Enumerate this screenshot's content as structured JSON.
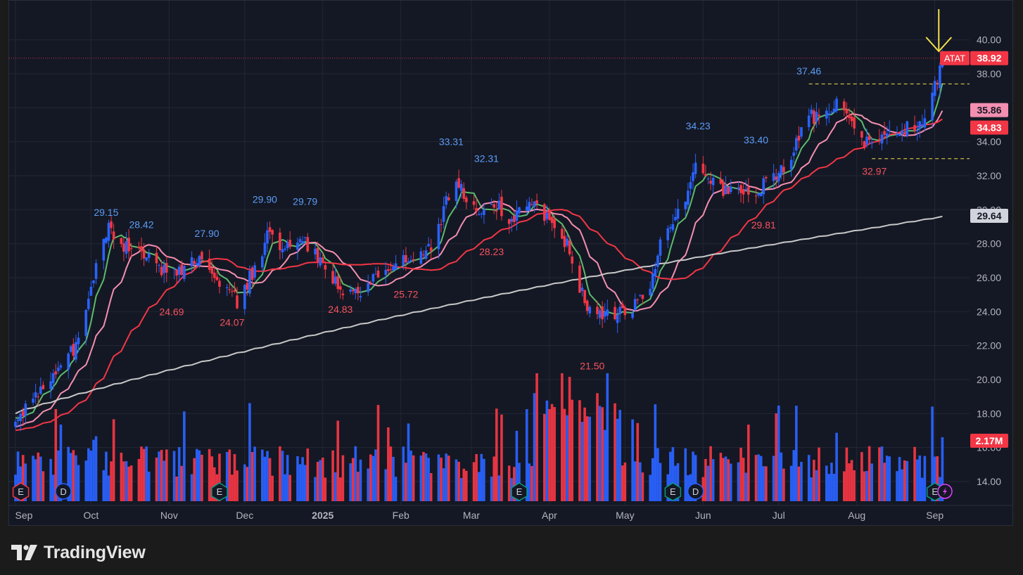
{
  "brand": {
    "name": "TradingView",
    "icon": "tradingview-logo-icon"
  },
  "chart_data": {
    "type": "candlestick",
    "symbol": "ATAT",
    "last_price": "38.92",
    "volume_last": "2.17M",
    "ylim": [
      12.8,
      42.3
    ],
    "price_ticks": [
      "14.00",
      "16.00",
      "18.00",
      "20.00",
      "22.00",
      "24.00",
      "26.00",
      "28.00",
      "30.00",
      "32.00",
      "34.00",
      "36.00",
      "38.00",
      "40.00"
    ],
    "price_tags": [
      {
        "label": "ATAT",
        "value": "38.92",
        "y": 38.92,
        "color": "#f23645"
      },
      {
        "label": "",
        "value": "35.86",
        "y": 35.86,
        "color": "#f48fb1"
      },
      {
        "label": "",
        "value": "34.83",
        "y": 34.83,
        "color": "#f23645"
      },
      {
        "label": "",
        "value": "29.64",
        "y": 29.64,
        "color": "#d1d4dc"
      }
    ],
    "x_labels": [
      {
        "text": "Sep",
        "day": 0
      },
      {
        "text": "Oct",
        "day": 30
      },
      {
        "text": "Nov",
        "day": 61
      },
      {
        "text": "Dec",
        "day": 91
      },
      {
        "text": "2025",
        "day": 122
      },
      {
        "text": "Feb",
        "day": 153
      },
      {
        "text": "Mar",
        "day": 181
      },
      {
        "text": "Apr",
        "day": 212
      },
      {
        "text": "May",
        "day": 242
      },
      {
        "text": "Jun",
        "day": 273
      },
      {
        "text": "Jul",
        "day": 303
      },
      {
        "text": "Aug",
        "day": 334
      },
      {
        "text": "Sep",
        "day": 365
      }
    ],
    "anchors": [
      [
        0,
        17.5
      ],
      [
        8,
        19.2
      ],
      [
        16,
        20.5
      ],
      [
        24,
        22.0
      ],
      [
        28,
        24.5
      ],
      [
        33,
        27.2
      ],
      [
        37,
        29.0
      ],
      [
        43,
        27.8
      ],
      [
        50,
        27.3
      ],
      [
        58,
        26.5
      ],
      [
        64,
        26.4
      ],
      [
        68,
        26.8
      ],
      [
        74,
        27.2
      ],
      [
        80,
        26.0
      ],
      [
        85,
        25.0
      ],
      [
        88,
        24.6
      ],
      [
        95,
        26.5
      ],
      [
        100,
        28.5
      ],
      [
        106,
        27.5
      ],
      [
        113,
        28.3
      ],
      [
        118,
        27.6
      ],
      [
        124,
        26.5
      ],
      [
        130,
        25.3
      ],
      [
        136,
        25.2
      ],
      [
        142,
        26.0
      ],
      [
        148,
        26.8
      ],
      [
        154,
        27.3
      ],
      [
        160,
        27.2
      ],
      [
        166,
        28.0
      ],
      [
        170,
        30.0
      ],
      [
        175,
        31.8
      ],
      [
        180,
        30.0
      ],
      [
        185,
        29.7
      ],
      [
        190,
        30.5
      ],
      [
        196,
        29.3
      ],
      [
        202,
        30.5
      ],
      [
        208,
        30.3
      ],
      [
        214,
        28.5
      ],
      [
        219,
        28.0
      ],
      [
        224,
        25.5
      ],
      [
        229,
        23.5
      ],
      [
        235,
        24.0
      ],
      [
        241,
        23.8
      ],
      [
        246,
        24.5
      ],
      [
        252,
        25.2
      ],
      [
        256,
        28.5
      ],
      [
        261,
        29.5
      ],
      [
        267,
        31.0
      ],
      [
        270,
        32.5
      ],
      [
        276,
        31.8
      ],
      [
        281,
        31.0
      ],
      [
        287,
        31.2
      ],
      [
        292,
        30.5
      ],
      [
        297,
        31.5
      ],
      [
        303,
        32.3
      ],
      [
        308,
        33.0
      ],
      [
        313,
        35.5
      ],
      [
        320,
        35.5
      ],
      [
        326,
        36.2
      ],
      [
        332,
        35.5
      ],
      [
        337,
        34.0
      ],
      [
        342,
        33.6
      ],
      [
        347,
        34.7
      ],
      [
        352,
        34.9
      ],
      [
        357,
        34.6
      ],
      [
        362,
        35.8
      ],
      [
        366,
        37.8
      ],
      [
        369,
        38.9
      ]
    ],
    "price_labels": [
      {
        "text": "29.15",
        "day": 36,
        "y": 29.15,
        "kind": "high"
      },
      {
        "text": "28.42",
        "day": 50,
        "y": 28.42,
        "kind": "high"
      },
      {
        "text": "27.90",
        "day": 76,
        "y": 27.9,
        "kind": "high"
      },
      {
        "text": "24.69",
        "day": 62,
        "y": 24.69,
        "kind": "low"
      },
      {
        "text": "24.07",
        "day": 86,
        "y": 24.07,
        "kind": "low"
      },
      {
        "text": "29.90",
        "day": 99,
        "y": 29.9,
        "kind": "high"
      },
      {
        "text": "29.79",
        "day": 115,
        "y": 29.79,
        "kind": "high"
      },
      {
        "text": "24.83",
        "day": 129,
        "y": 24.83,
        "kind": "low"
      },
      {
        "text": "25.72",
        "day": 155,
        "y": 25.72,
        "kind": "low"
      },
      {
        "text": "33.31",
        "day": 173,
        "y": 33.31,
        "kind": "high"
      },
      {
        "text": "32.31",
        "day": 187,
        "y": 32.31,
        "kind": "high"
      },
      {
        "text": "28.23",
        "day": 189,
        "y": 28.23,
        "kind": "low"
      },
      {
        "text": "21.50",
        "day": 229,
        "y": 21.5,
        "kind": "low"
      },
      {
        "text": "34.23",
        "day": 271,
        "y": 34.23,
        "kind": "high"
      },
      {
        "text": "33.40",
        "day": 294,
        "y": 33.4,
        "kind": "high"
      },
      {
        "text": "29.81",
        "day": 297,
        "y": 29.81,
        "kind": "low"
      },
      {
        "text": "37.46",
        "day": 315,
        "y": 37.46,
        "kind": "high"
      },
      {
        "text": "32.97",
        "day": 341,
        "y": 32.97,
        "kind": "low"
      }
    ],
    "levels": [
      {
        "y": 37.4,
        "from_day": 315,
        "color": "#f4e04d"
      },
      {
        "y": 33.0,
        "from_day": 340,
        "color": "#f4e04d"
      }
    ],
    "moving_averages": [
      {
        "color": "#5cba6b",
        "period": 8,
        "start": 17.8,
        "end": 36.2
      },
      {
        "color": "#f48fb1",
        "period": 21,
        "start": 17.2,
        "end": 35.86
      },
      {
        "color": "#f23645",
        "period": 50,
        "start": 17.0,
        "end": 34.83
      },
      {
        "color": "#c8c8c8",
        "period": 200,
        "start": 18.0,
        "end": 29.64
      }
    ],
    "events": [
      {
        "type": "E",
        "day": 1,
        "color": "#f23645"
      },
      {
        "type": "D",
        "day": 19,
        "color": "#2962ff"
      },
      {
        "type": "E",
        "day": 81,
        "color": "#089981"
      },
      {
        "type": "E",
        "day": 200,
        "color": "#089981"
      },
      {
        "type": "E",
        "day": 261,
        "color": "#089981"
      },
      {
        "type": "D",
        "day": 270,
        "color": "#2962ff"
      },
      {
        "type": "E",
        "day": 365,
        "color": "#089981"
      },
      {
        "type": "lightning",
        "day": 369,
        "color": "#e040fb"
      }
    ],
    "arrow_day": 366,
    "up_color": "#2962ff",
    "down_color": "#f23645"
  }
}
